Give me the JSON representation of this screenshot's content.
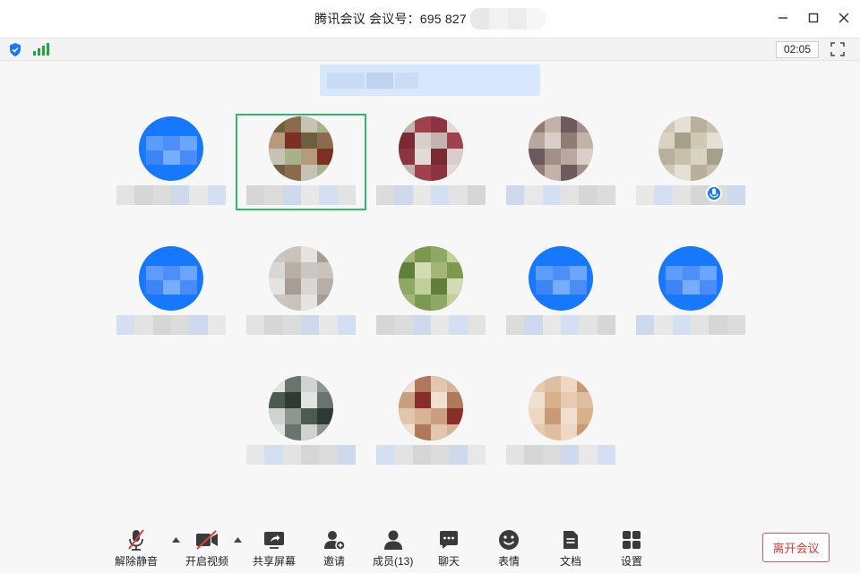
{
  "window": {
    "title": "腾讯会议 会议号：695 827",
    "timer": "02:05"
  },
  "status": {
    "security_icon": "shield-icon",
    "network_icon": "signal-bars-icon",
    "accent": "#1677ff",
    "signal_color": "#1aab3c"
  },
  "participants": [
    {
      "avatar_kind": "default-blue"
    },
    {
      "avatar_kind": "photo",
      "active_speaker": true
    },
    {
      "avatar_kind": "photo"
    },
    {
      "avatar_kind": "photo"
    },
    {
      "avatar_kind": "photo",
      "mic_icon": "microphone-icon"
    },
    {
      "avatar_kind": "default-blue"
    },
    {
      "avatar_kind": "photo"
    },
    {
      "avatar_kind": "photo"
    },
    {
      "avatar_kind": "default-blue"
    },
    {
      "avatar_kind": "default-blue"
    },
    {
      "avatar_kind": "photo"
    },
    {
      "avatar_kind": "photo"
    },
    {
      "avatar_kind": "photo"
    }
  ],
  "toolbar": {
    "unmute": "解除静音",
    "start_video": "开启视频",
    "share_screen": "共享屏幕",
    "invite": "邀请",
    "members": "成员(13)",
    "chat": "聊天",
    "reactions": "表情",
    "docs": "文档",
    "settings": "设置",
    "leave": "离开会议",
    "leave_color": "#e03a3a"
  }
}
